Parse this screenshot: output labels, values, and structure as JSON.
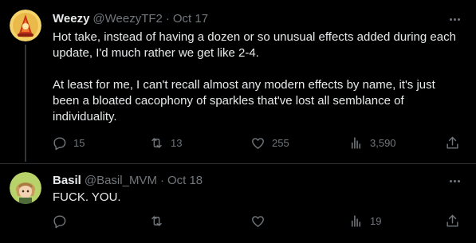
{
  "tweets": [
    {
      "author_name": "Weezy",
      "handle": "@WeezyTF2",
      "separator": "·",
      "date": "Oct 17",
      "text": "Hot take, instead of having a dozen or so unusual effects added during each update, I'd much rather we get like 2-4.\n\nAt least for me, I can't recall almost any modern effects by name, it's just been a bloated cacophony of sparkles that've lost all semblance of individuality.",
      "replies": "15",
      "retweets": "13",
      "likes": "255",
      "views": "3,590",
      "avatar_icon": "orange-mascot-avatar"
    },
    {
      "author_name": "Basil",
      "handle": "@Basil_MVM",
      "separator": "·",
      "date": "Oct 18",
      "text": "FUCK. YOU.",
      "replies": "",
      "retweets": "",
      "likes": "",
      "views": "19",
      "avatar_icon": "anime-character-avatar"
    }
  ],
  "icons": {
    "reply": "reply-icon",
    "retweet": "retweet-icon",
    "like": "heart-icon",
    "views": "views-chart-icon",
    "share": "share-icon",
    "more": "more-dots-icon"
  },
  "colors": {
    "background": "#000000",
    "text": "#e7e9ea",
    "muted": "#71767b",
    "divider": "#2f3336"
  }
}
